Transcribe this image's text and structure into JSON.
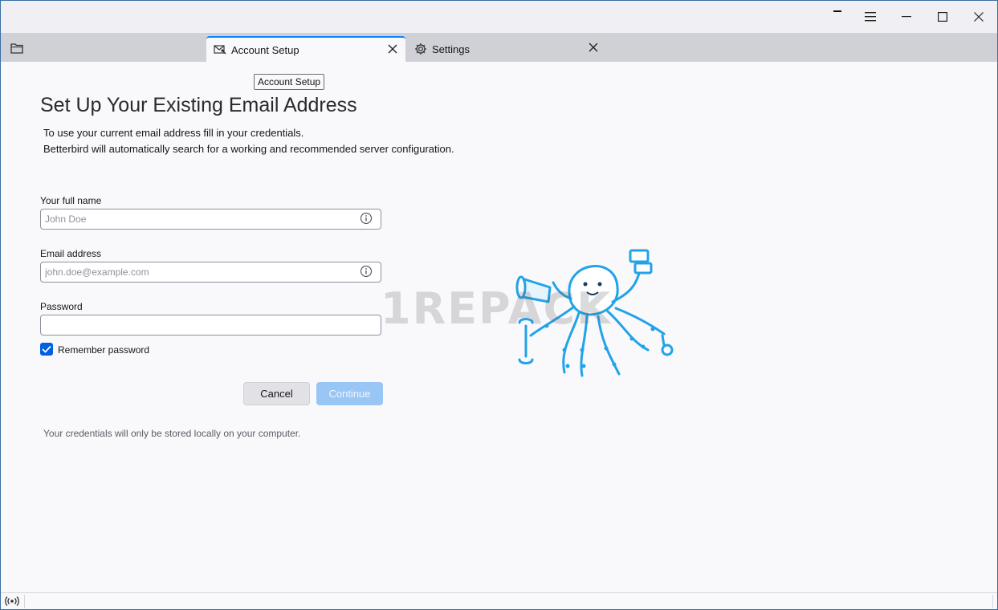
{
  "tabs": [
    {
      "label": "Account Setup",
      "icon": "mail-setup-icon",
      "active": true
    },
    {
      "label": "Settings",
      "icon": "gear-icon",
      "active": false
    }
  ],
  "tooltip": "Account Setup",
  "page": {
    "title": "Set Up Your Existing Email Address",
    "intro_line1": "To use your current email address fill in your credentials.",
    "intro_line2": "Betterbird will automatically search for a working and recommended server configuration."
  },
  "form": {
    "full_name": {
      "label": "Your full name",
      "placeholder": "John Doe",
      "value": ""
    },
    "email": {
      "label": "Email address",
      "placeholder": "john.doe@example.com",
      "value": ""
    },
    "password": {
      "label": "Password",
      "value": ""
    },
    "remember": {
      "label": "Remember password",
      "checked": true
    }
  },
  "buttons": {
    "cancel": "Cancel",
    "continue": "Continue"
  },
  "footer_note": "Your credentials will only be stored locally on your computer.",
  "watermark": "1REPACK",
  "colors": {
    "accent": "#0a84ff",
    "checkbox": "#0061e0",
    "continue_disabled": "#99c6f5",
    "mascot": "#22a3e8"
  }
}
